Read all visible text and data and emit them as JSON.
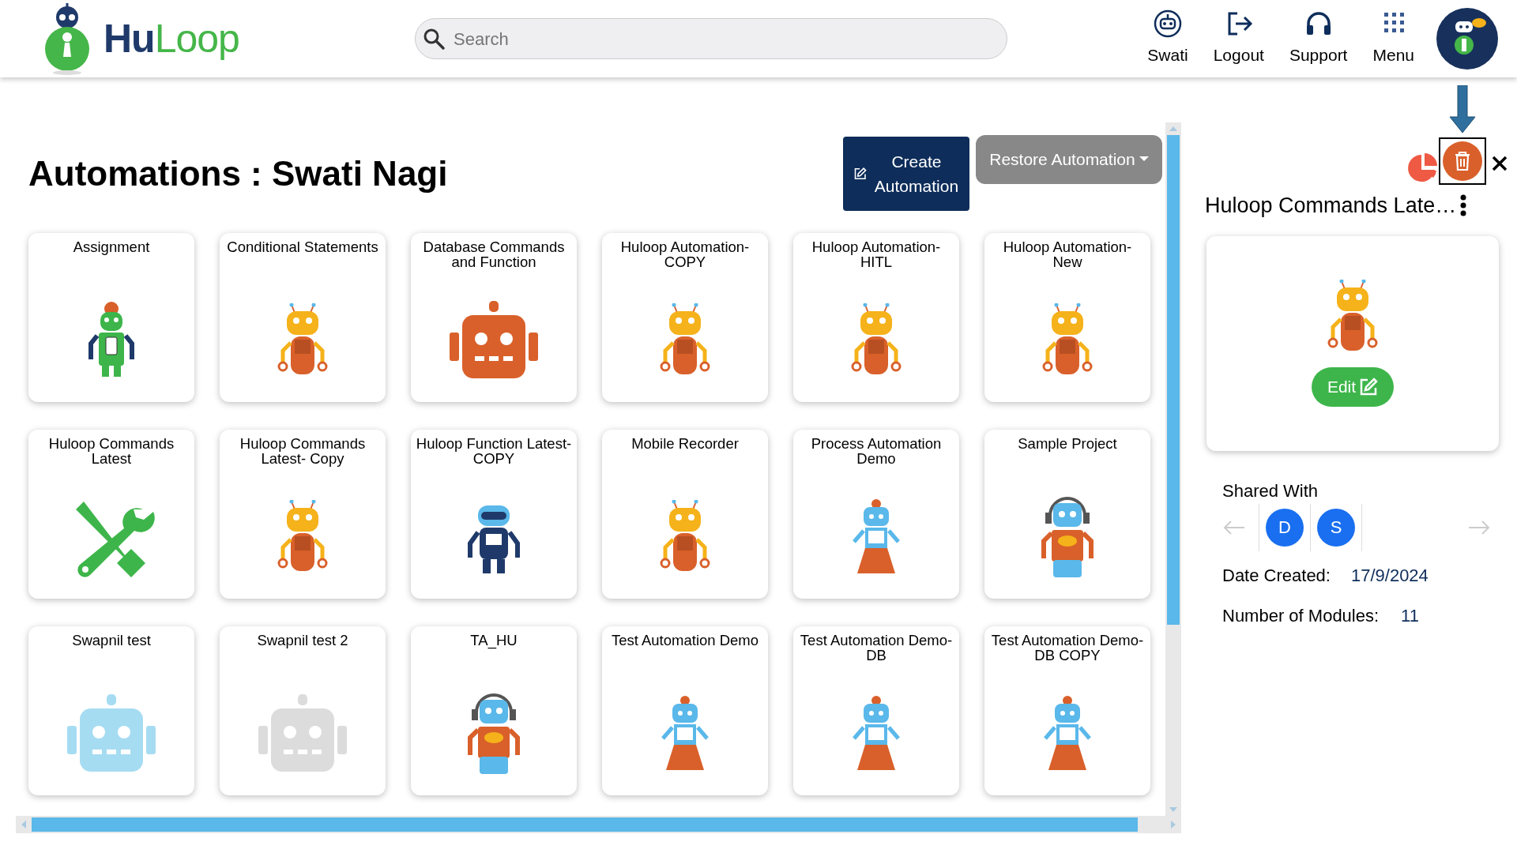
{
  "header": {
    "brand_parts": [
      "Hu",
      "Loop"
    ],
    "search": {
      "placeholder": "Search"
    },
    "nav": [
      {
        "kind": "user",
        "label": "Swati"
      },
      {
        "kind": "logout",
        "label": "Logout"
      },
      {
        "kind": "support",
        "label": "Support"
      },
      {
        "kind": "menu",
        "label": "Menu"
      }
    ]
  },
  "page": {
    "title": "Automations : Swati Nagi",
    "create_button": "Create Automation",
    "restore_button": "Restore Automation",
    "cards": [
      {
        "title": "Assignment",
        "kind": "green-robot",
        "selected": false
      },
      {
        "title": "Conditional Statements",
        "kind": "orange-robot",
        "selected": false
      },
      {
        "title": "Database Commands and Function",
        "kind": "robot-head",
        "color": "#d9602a",
        "selected": false
      },
      {
        "title": "Huloop Automation-COPY",
        "kind": "orange-robot",
        "selected": false
      },
      {
        "title": "Huloop Automation-HITL",
        "kind": "orange-robot",
        "selected": false
      },
      {
        "title": "Huloop Automation-New",
        "kind": "orange-robot",
        "selected": false
      },
      {
        "title": "Huloop Commands Latest",
        "kind": "tools",
        "selected": false
      },
      {
        "title": "Huloop Commands Latest- Copy",
        "kind": "orange-robot",
        "selected": false
      },
      {
        "title": "Huloop Function Latest-COPY",
        "kind": "navy-robot",
        "selected": false
      },
      {
        "title": "Mobile Recorder",
        "kind": "orange-robot",
        "selected": false
      },
      {
        "title": "Process Automation Demo",
        "kind": "dress-robot",
        "selected": false
      },
      {
        "title": "Sample Project",
        "kind": "headset-robot",
        "selected": false
      },
      {
        "title": "Swapnil test",
        "kind": "robot-head",
        "color": "#a6dcf2",
        "selected": false
      },
      {
        "title": "Swapnil test 2",
        "kind": "robot-head",
        "color": "#dcdcdc",
        "selected": false
      },
      {
        "title": "TA_HU",
        "kind": "headset-robot",
        "selected": false
      },
      {
        "title": "Test Automation Demo",
        "kind": "dress-robot",
        "selected": false
      },
      {
        "title": "Test Automation Demo-DB",
        "kind": "dress-robot",
        "selected": false
      },
      {
        "title": "Test Automation Demo-DB COPY",
        "kind": "dress-robot",
        "selected": false
      }
    ]
  },
  "details": {
    "title": "Huloop Commands Late…",
    "edit_button": "Edit",
    "shared_with_label": "Shared With",
    "shared_with": [
      {
        "initial": "D"
      },
      {
        "initial": "S"
      }
    ],
    "fields": [
      {
        "label": "Date Created:",
        "value": "17/9/2024"
      },
      {
        "label": "Number of Modules:",
        "value": "11"
      }
    ]
  }
}
